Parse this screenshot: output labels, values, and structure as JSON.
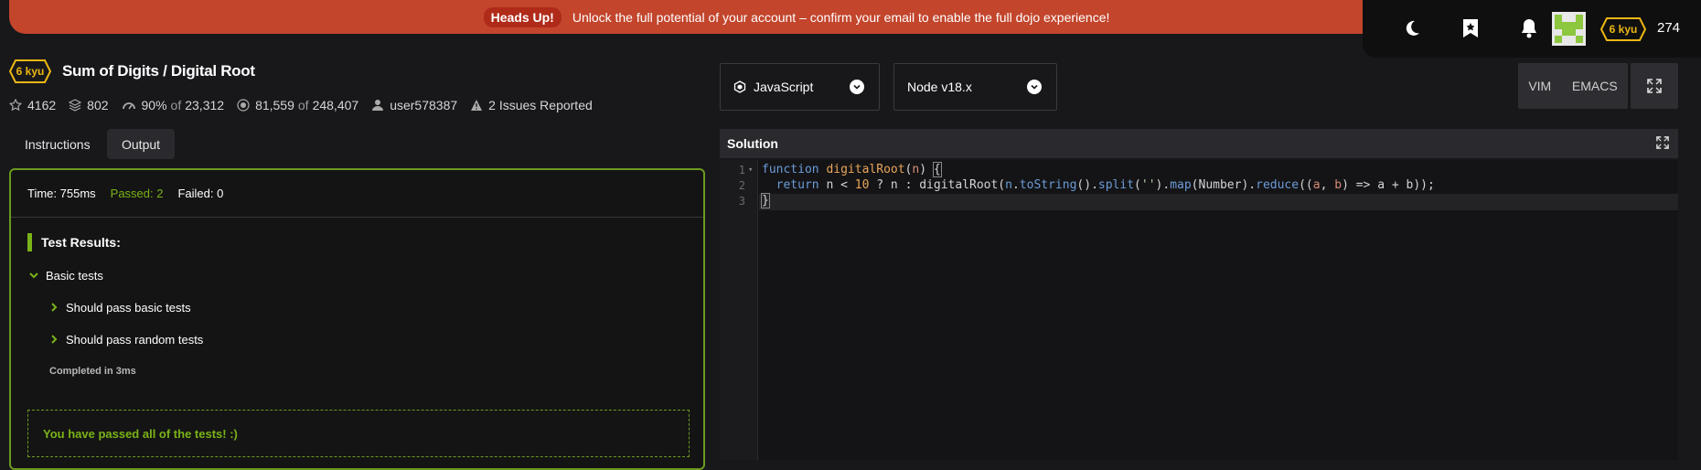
{
  "banner": {
    "pill": "Heads Up!",
    "message": "Unlock the full potential of your account – confirm your email to enable the full dojo experience!"
  },
  "user": {
    "rank": "6 kyu",
    "honor": "274"
  },
  "kata": {
    "rank": "6 kyu",
    "title": "Sum of Digits / Digital Root",
    "stars": "4162",
    "collections": "802",
    "satisfaction_pct": "90%",
    "satisfaction_of": "of",
    "satisfaction_votes": "23,312",
    "completed": "81,559",
    "completed_of": "of",
    "attempts": "248,407",
    "author": "user578387",
    "issues": "2 Issues Reported"
  },
  "tabs": {
    "instructions": "Instructions",
    "output": "Output"
  },
  "output": {
    "time": "Time: 755ms",
    "passed": "Passed: 2",
    "failed": "Failed: 0",
    "results_title": "Test Results:",
    "group": "Basic tests",
    "test1": "Should pass basic tests",
    "test2": "Should pass random tests",
    "completed": "Completed in 3ms",
    "success": "You have passed all of the tests! :)"
  },
  "editor": {
    "language": "JavaScript",
    "version": "Node v18.x",
    "vim": "VIM",
    "emacs": "EMACS",
    "panel_title": "Solution",
    "line_numbers": [
      "1",
      "2",
      "3"
    ]
  },
  "colors": {
    "banner": "#c2452c",
    "rank_yellow": "#ecb613",
    "pass_green": "#7ab317",
    "border_green": "#6c9a1f"
  }
}
